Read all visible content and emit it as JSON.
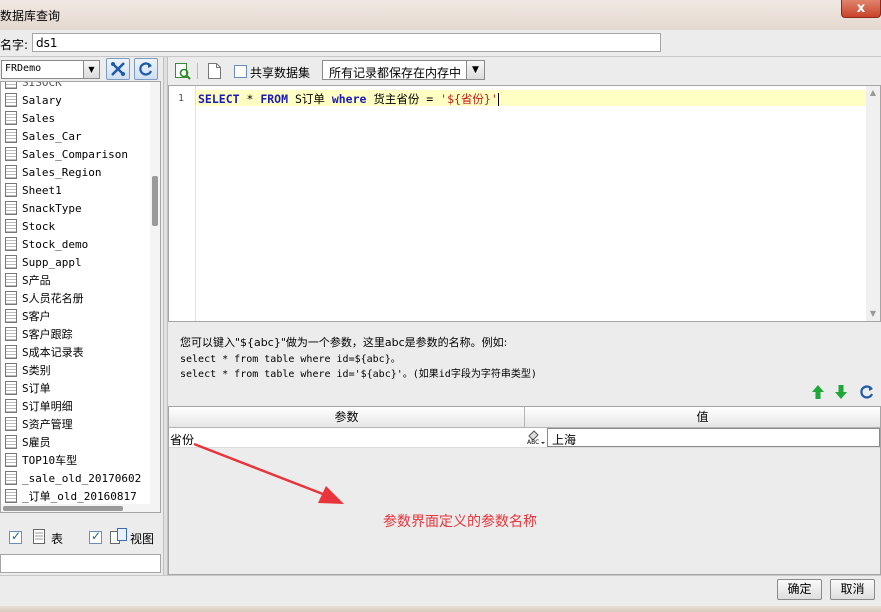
{
  "window": {
    "title": "数据库查询",
    "close_glyph": "x"
  },
  "name_field": {
    "label": "名字:",
    "value": "ds1"
  },
  "left": {
    "connection": "FRDemo",
    "items": [
      "Salary",
      "Sales",
      "Sales_Car",
      "Sales_Comparison",
      "Sales_Region",
      "Sheet1",
      "SnackType",
      "Stock",
      "Stock_demo",
      "Supp_appl",
      "S产品",
      "S人员花名册",
      "S客户",
      "S客户跟踪",
      "S成本记录表",
      "S类别",
      "S订单",
      "S订单明细",
      "S资产管理",
      "S雇员",
      "TOP10车型",
      "_sale_old_20170602",
      "_订单_old_20160817"
    ],
    "filter_table": "表",
    "filter_view": "视图"
  },
  "toolbar": {
    "share_label": "共享数据集",
    "mode": "所有记录都保存在内存中"
  },
  "editor": {
    "line_number": "1",
    "kw_select": "SELECT",
    "star": " * ",
    "kw_from": "FROM",
    "table": " S订单 ",
    "kw_where": "where",
    "cond": " 货主省份 = ",
    "str": "'${省份}'"
  },
  "help": {
    "line1": "您可以键入\"${abc}\"做为一个参数，这里abc是参数的名称。例如:",
    "line2": "select * from table where id=${abc}。",
    "line3": "select * from table where id='${abc}'。(如果id字段为字符串类型)"
  },
  "params": {
    "col_param": "参数",
    "col_value": "值",
    "rows": [
      {
        "name": "省份",
        "type_label": "ABC",
        "value": "上海"
      }
    ]
  },
  "annotation": {
    "text": "参数界面定义的参数名称",
    "color": "#e8343a"
  },
  "footer": {
    "ok": "确定",
    "cancel": "取消"
  }
}
